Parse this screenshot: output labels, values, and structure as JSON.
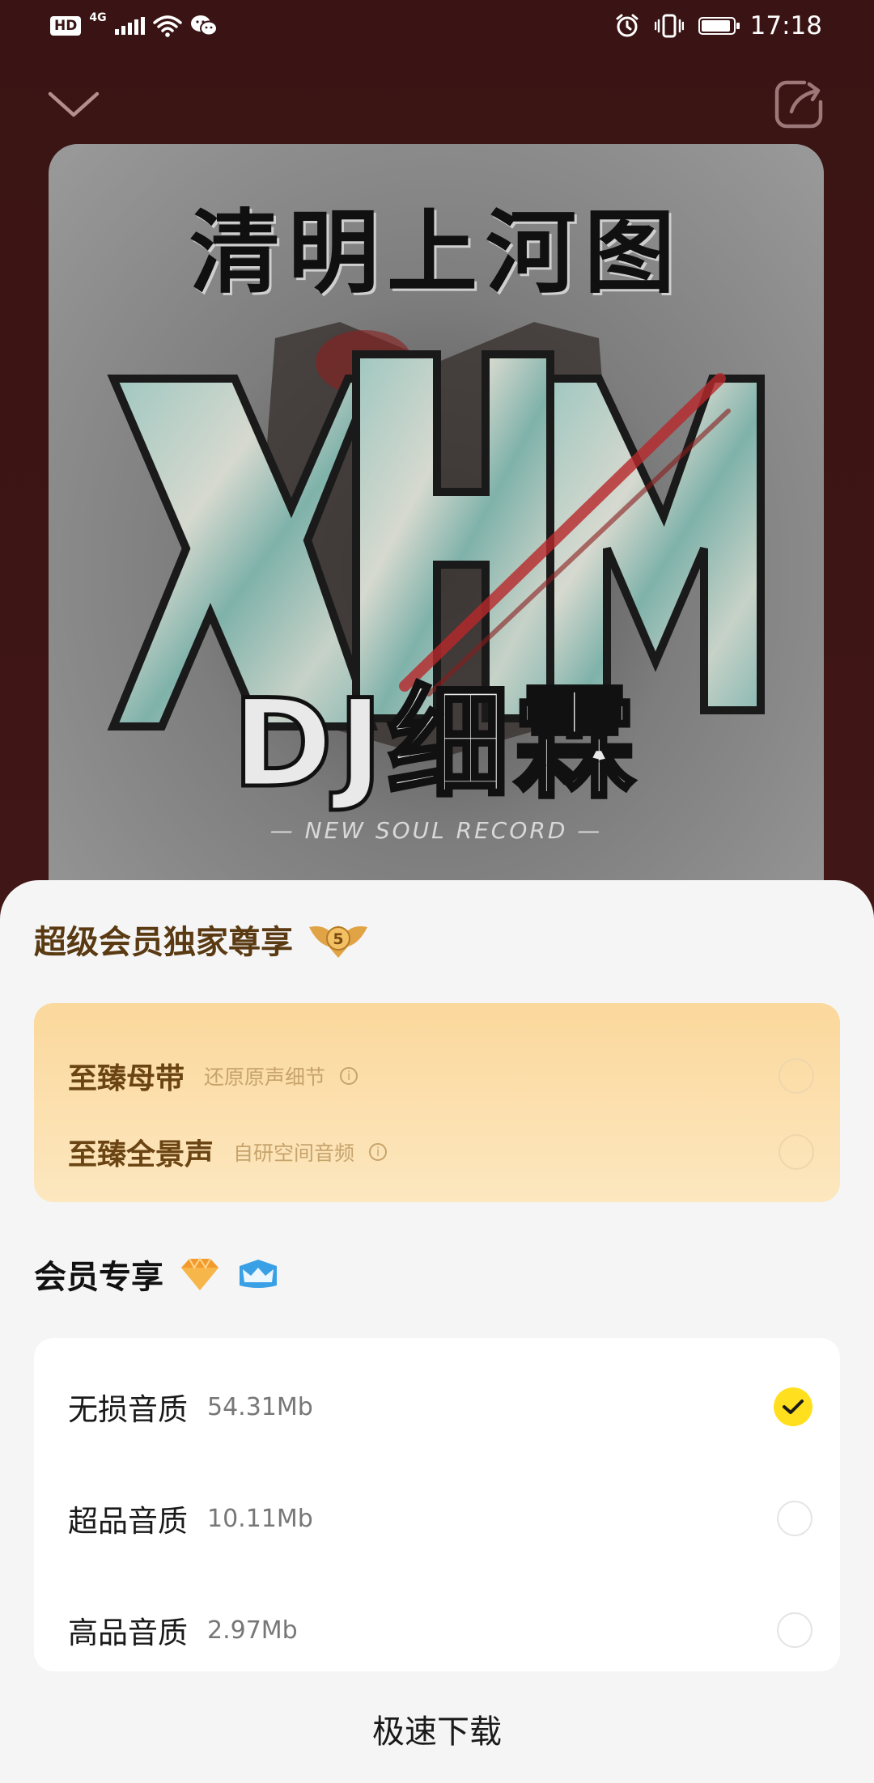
{
  "status_bar": {
    "hd_label": "HD",
    "network_label": "4G",
    "time": "17:18",
    "battery_level": 0.95,
    "icons": [
      "signal-icon",
      "wifi-icon",
      "wechat-icon",
      "alarm-icon",
      "vibrate-icon",
      "battery-icon"
    ]
  },
  "header": {
    "collapse_icon": "chevron-down-icon",
    "share_icon": "share-icon"
  },
  "album": {
    "title": "清明上河图",
    "logo_text": "XHM",
    "artist": "DJ细霖",
    "tagline": "— NEW SOUL RECORD —"
  },
  "svip_section": {
    "title": "超级会员独家尊享",
    "badge": "5",
    "options": [
      {
        "label": "至臻母带",
        "desc": "还原原声细节",
        "selected": false
      },
      {
        "label": "至臻全景声",
        "desc": "自研空间音频",
        "selected": false
      }
    ]
  },
  "vip_section": {
    "title": "会员专享",
    "icons": [
      "diamond-icon",
      "vip-card-icon"
    ],
    "options": [
      {
        "label": "无损音质",
        "size": "54.31Mb",
        "selected": true
      },
      {
        "label": "超品音质",
        "size": "10.11Mb",
        "selected": false
      },
      {
        "label": "高品音质",
        "size": "2.97Mb",
        "selected": false
      }
    ]
  },
  "actions": {
    "download_label": "极速下载"
  },
  "colors": {
    "background": "#3f1515",
    "svip_card": "#fbd89c",
    "accent_check": "#ffdf1e"
  }
}
